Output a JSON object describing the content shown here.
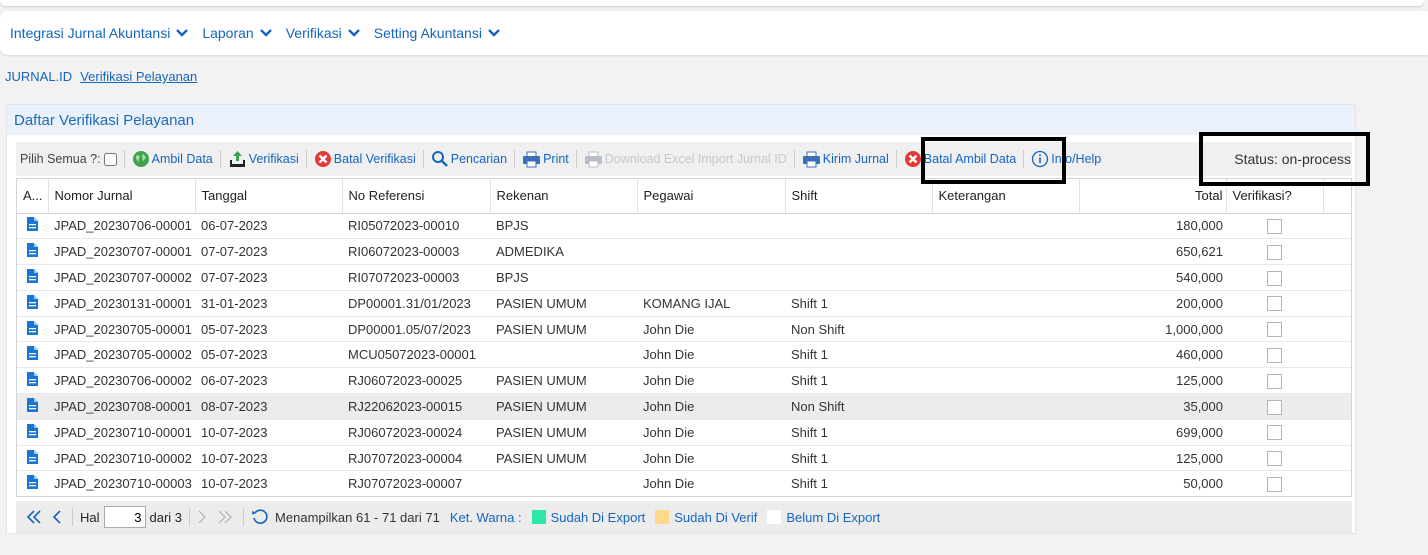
{
  "menu": [
    {
      "label": "Integrasi Jurnal Akuntansi"
    },
    {
      "label": "Laporan"
    },
    {
      "label": "Verifikasi"
    },
    {
      "label": "Setting Akuntansi"
    }
  ],
  "breadcrumb": {
    "root": "JURNAL.ID",
    "active": "Verifikasi Pelayanan"
  },
  "panel": {
    "title": "Daftar Verifikasi Pelayanan"
  },
  "toolbar": {
    "select_all": "Pilih Semua ?:",
    "ambil_data": "Ambil Data",
    "verifikasi": "Verifikasi",
    "batal_verifikasi": "Batal Verifikasi",
    "pencarian": "Pencarian",
    "print": "Print",
    "download_excel": "Download Excel Import Jurnal ID",
    "kirim_jurnal": "Kirim Jurnal",
    "batal_ambil_data": "Batal Ambil Data",
    "info_help": "Info/Help",
    "status": "Status: on-process"
  },
  "table": {
    "columns": [
      "A...",
      "Nomor Jurnal",
      "Tanggal",
      "No Referensi",
      "Rekenan",
      "Pegawai",
      "Shift",
      "Keterangan",
      "Total",
      "Verifikasi?"
    ],
    "rows": [
      {
        "nomor": "JPAD_20230706-00001",
        "tanggal": "06-07-2023",
        "ref": "RI05072023-00010",
        "rekenan": "BPJS",
        "pegawai": "",
        "shift": "",
        "ket": "",
        "total": "180,000"
      },
      {
        "nomor": "JPAD_20230707-00001",
        "tanggal": "07-07-2023",
        "ref": "RI06072023-00003",
        "rekenan": "ADMEDIKA",
        "pegawai": "",
        "shift": "",
        "ket": "",
        "total": "650,621"
      },
      {
        "nomor": "JPAD_20230707-00002",
        "tanggal": "07-07-2023",
        "ref": "RI07072023-00003",
        "rekenan": "BPJS",
        "pegawai": "",
        "shift": "",
        "ket": "",
        "total": "540,000"
      },
      {
        "nomor": "JPAD_20230131-00001",
        "tanggal": "31-01-2023",
        "ref": "DP00001.31/01/2023",
        "rekenan": "PASIEN UMUM",
        "pegawai": "KOMANG IJAL",
        "shift": "Shift 1",
        "ket": "",
        "total": "200,000"
      },
      {
        "nomor": "JPAD_20230705-00001",
        "tanggal": "05-07-2023",
        "ref": "DP00001.05/07/2023",
        "rekenan": "PASIEN UMUM",
        "pegawai": "John Die",
        "shift": "Non Shift",
        "ket": "",
        "total": "1,000,000"
      },
      {
        "nomor": "JPAD_20230705-00002",
        "tanggal": "05-07-2023",
        "ref": "MCU05072023-00001",
        "rekenan": "",
        "pegawai": "John Die",
        "shift": "Shift 1",
        "ket": "",
        "total": "460,000"
      },
      {
        "nomor": "JPAD_20230706-00002",
        "tanggal": "06-07-2023",
        "ref": "RJ06072023-00025",
        "rekenan": "PASIEN UMUM",
        "pegawai": "John Die",
        "shift": "Shift 1",
        "ket": "",
        "total": "125,000"
      },
      {
        "nomor": "JPAD_20230708-00001",
        "tanggal": "08-07-2023",
        "ref": "RJ22062023-00015",
        "rekenan": "PASIEN UMUM",
        "pegawai": "John Die",
        "shift": "Non Shift",
        "ket": "",
        "total": "35,000"
      },
      {
        "nomor": "JPAD_20230710-00001",
        "tanggal": "10-07-2023",
        "ref": "RJ06072023-00024",
        "rekenan": "PASIEN UMUM",
        "pegawai": "John Die",
        "shift": "Shift 1",
        "ket": "",
        "total": "699,000"
      },
      {
        "nomor": "JPAD_20230710-00002",
        "tanggal": "10-07-2023",
        "ref": "RJ07072023-00004",
        "rekenan": "PASIEN UMUM",
        "pegawai": "John Die",
        "shift": "Shift 1",
        "ket": "",
        "total": "125,000"
      },
      {
        "nomor": "JPAD_20230710-00003",
        "tanggal": "10-07-2023",
        "ref": "RJ07072023-00007",
        "rekenan": "",
        "pegawai": "John Die",
        "shift": "Shift 1",
        "ket": "",
        "total": "50,000"
      }
    ],
    "selected_row": 7
  },
  "pager": {
    "hal_label": "Hal",
    "page": "3",
    "of_label": "dari 3",
    "summary": "Menampilkan 61 - 71 dari 71",
    "legend_title": "Ket. Warna :",
    "legend": [
      {
        "label": "Sudah Di Export",
        "color": "#2ee6a6"
      },
      {
        "label": "Sudah Di Verif",
        "color": "#ffd98a"
      },
      {
        "label": "Belum Di Export",
        "color": "#ffffff"
      }
    ]
  },
  "colors": {
    "accent": "#1565c0",
    "danger": "#e53935"
  }
}
